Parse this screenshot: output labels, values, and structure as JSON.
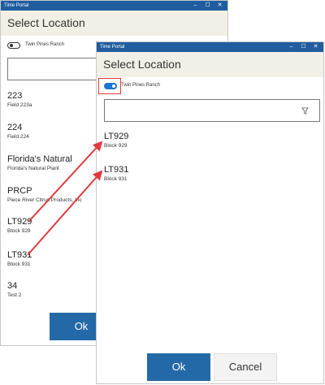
{
  "back_window": {
    "title": "Time Portal",
    "header": "Select Location",
    "toggle_label": "Twin Pines Ranch",
    "items": [
      {
        "code": "223",
        "desc": "Field 223a"
      },
      {
        "code": "224",
        "desc": "Field 224"
      },
      {
        "code": "Florida's Natural",
        "desc": "Florida's Natural Plant"
      },
      {
        "code": "PRCP",
        "desc": "Piece River Citrus Products, Inc"
      },
      {
        "code": "LT929",
        "desc": "Block 929"
      },
      {
        "code": "LT931",
        "desc": "Block 931"
      },
      {
        "code": "34",
        "desc": "Test 2"
      }
    ],
    "ok_label": "Ok"
  },
  "front_window": {
    "title": "Time Portal",
    "header": "Select Location",
    "toggle_label": "Twin Pines Ranch",
    "items": [
      {
        "code": "LT929",
        "desc": "Block 929"
      },
      {
        "code": "LT931",
        "desc": "Block 931"
      }
    ],
    "ok_label": "Ok",
    "cancel_label": "Cancel"
  },
  "window_controls": {
    "minimize": "–",
    "maximize": "☐",
    "close": "✕"
  },
  "colors": {
    "annotation_red": "#e03a3a",
    "accent_blue": "#2469a7",
    "titlebar": "#1f5d9e"
  }
}
